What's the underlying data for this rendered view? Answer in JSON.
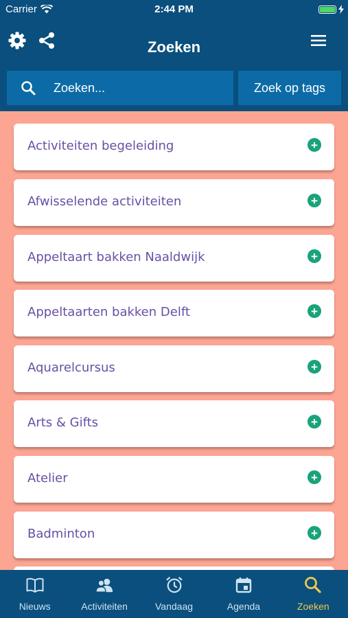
{
  "status": {
    "carrier": "Carrier",
    "time": "2:44 PM"
  },
  "header": {
    "title": "Zoeken"
  },
  "search": {
    "placeholder": "Zoeken...",
    "tag_button": "Zoek op tags"
  },
  "colors": {
    "primary": "#0a4f7e",
    "search_bg": "#0c6ba6",
    "list_bg": "#fda593",
    "item_text": "#6750a4",
    "add_icon": "#1aa37a",
    "active_tab": "#f2c94c"
  },
  "items": [
    {
      "label": "Activiteiten begeleiding"
    },
    {
      "label": "Afwisselende activiteiten"
    },
    {
      "label": "Appeltaart bakken Naaldwijk"
    },
    {
      "label": "Appeltaarten bakken Delft"
    },
    {
      "label": "Aquarelcursus"
    },
    {
      "label": "Arts & Gifts"
    },
    {
      "label": "Atelier"
    },
    {
      "label": "Badminton"
    },
    {
      "label": ""
    }
  ],
  "tabs": [
    {
      "label": "Nieuws",
      "icon": "book-icon",
      "active": false
    },
    {
      "label": "Activiteiten",
      "icon": "people-icon",
      "active": false
    },
    {
      "label": "Vandaag",
      "icon": "alarm-clock-icon",
      "active": false
    },
    {
      "label": "Agenda",
      "icon": "calendar-icon",
      "active": false
    },
    {
      "label": "Zoeken",
      "icon": "search-icon",
      "active": true
    }
  ]
}
